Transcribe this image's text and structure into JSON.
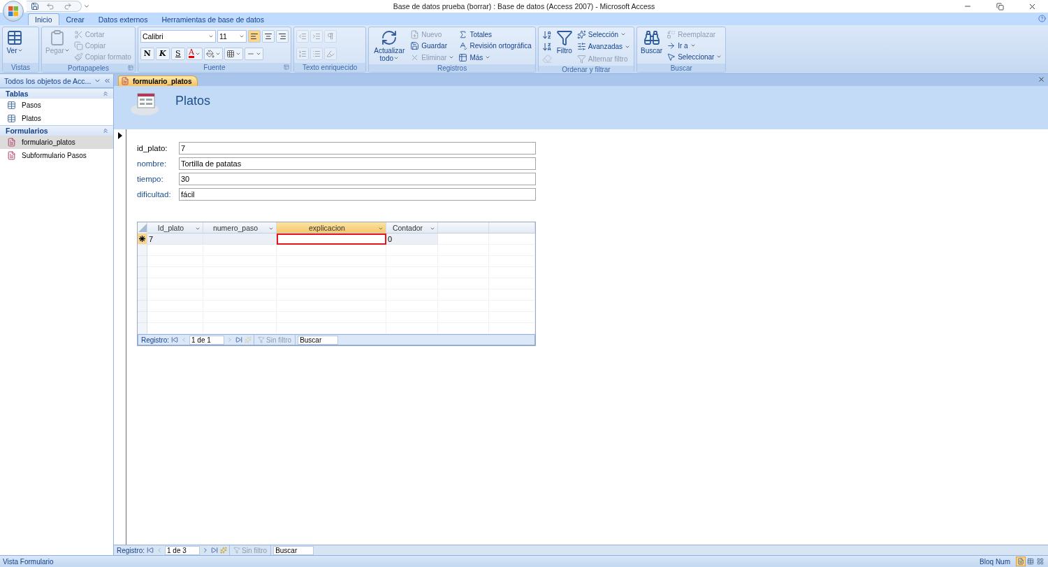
{
  "window": {
    "title": "Base de datos prueba (borrar) : Base de datos (Access 2007) - Microsoft Access"
  },
  "ribbon_tabs": [
    {
      "label": "Inicio",
      "selected": true
    },
    {
      "label": "Crear",
      "selected": false
    },
    {
      "label": "Datos externos",
      "selected": false
    },
    {
      "label": "Herramientas de base de datos",
      "selected": false
    }
  ],
  "ribbon_groups": [
    {
      "title": "Vistas",
      "kind": "buttons",
      "launcher": false,
      "columns": [
        [
          {
            "label": "Ver",
            "kind": "large",
            "dropdown": true,
            "disabled": false
          }
        ]
      ]
    },
    {
      "title": "Portapapeles",
      "kind": "buttons",
      "launcher": true,
      "columns": [
        [
          {
            "label": "Pegar",
            "kind": "large",
            "dropdown": true,
            "disabled": true
          }
        ],
        [
          {
            "label": "Cortar",
            "kind": "small",
            "dropdown": false,
            "disabled": true
          },
          {
            "label": "Copiar",
            "kind": "small",
            "dropdown": false,
            "disabled": true
          },
          {
            "label": "Copiar formato",
            "kind": "small",
            "dropdown": false,
            "disabled": true
          }
        ]
      ]
    },
    {
      "title": "Fuente",
      "kind": "font",
      "launcher": true,
      "font": "Calibri",
      "size": "11",
      "align": [
        {
          "selected": true
        },
        {
          "selected": false
        },
        {
          "selected": false
        }
      ],
      "format_buttons": [
        "N",
        "K",
        "S"
      ],
      "font_color_label": "A"
    },
    {
      "title": "Texto enriquecido",
      "kind": "icons",
      "launcher": false
    },
    {
      "title": "Registros",
      "kind": "buttons",
      "launcher": false,
      "columns": [
        [
          {
            "label": "Actualizar todo",
            "kind": "large",
            "dropdown": true,
            "disabled": false
          }
        ],
        [
          {
            "label": "Nuevo",
            "kind": "small",
            "dropdown": false,
            "disabled": true
          },
          {
            "label": "Guardar",
            "kind": "small",
            "dropdown": false,
            "disabled": false
          },
          {
            "label": "Eliminar",
            "kind": "small",
            "dropdown": true,
            "disabled": true
          }
        ],
        [
          {
            "label": "Totales",
            "kind": "small",
            "dropdown": false,
            "disabled": false
          },
          {
            "label": "Revisión ortográfica",
            "kind": "small",
            "dropdown": false,
            "disabled": false
          },
          {
            "label": "Más",
            "kind": "small",
            "dropdown": true,
            "disabled": false
          }
        ]
      ]
    },
    {
      "title": "Ordenar y filtrar",
      "kind": "buttons",
      "launcher": false,
      "columns": [
        [
          {
            "kind": "icon",
            "disabled": false
          },
          {
            "kind": "icon",
            "disabled": false
          },
          {
            "kind": "icon",
            "disabled": true
          }
        ],
        [
          {
            "label": "Filtro",
            "kind": "large",
            "dropdown": false,
            "disabled": false
          }
        ],
        [
          {
            "label": "Selección",
            "kind": "small",
            "dropdown": true,
            "disabled": false
          },
          {
            "label": "Avanzadas",
            "kind": "small",
            "dropdown": true,
            "disabled": false
          },
          {
            "label": "Alternar filtro",
            "kind": "small",
            "dropdown": false,
            "disabled": true
          }
        ]
      ]
    },
    {
      "title": "Buscar",
      "kind": "buttons",
      "launcher": false,
      "columns": [
        [
          {
            "label": "Buscar",
            "kind": "large",
            "dropdown": false,
            "disabled": false
          }
        ],
        [
          {
            "label": "Reemplazar",
            "kind": "small",
            "dropdown": false,
            "disabled": true
          },
          {
            "label": "Ir a",
            "kind": "small",
            "dropdown": true,
            "disabled": false
          },
          {
            "label": "Seleccionar",
            "kind": "small",
            "dropdown": true,
            "disabled": false
          }
        ]
      ]
    }
  ],
  "nav_pane": {
    "title": "Todos los objetos de Acc...",
    "sections": [
      {
        "title": "Tablas",
        "expanded": true,
        "items": [
          {
            "label": "Pasos",
            "kind": "table",
            "selected": false
          },
          {
            "label": "Platos",
            "kind": "table",
            "selected": false
          }
        ]
      },
      {
        "title": "Formularios",
        "expanded": true,
        "items": [
          {
            "label": "formulario_platos",
            "kind": "form",
            "selected": true
          },
          {
            "label": "Subformulario Pasos",
            "kind": "form",
            "selected": false
          }
        ]
      }
    ]
  },
  "document_tab": {
    "label": "formulario_platos",
    "selected": true
  },
  "form": {
    "title": "Platos",
    "fields": [
      {
        "label": "id_plato:",
        "value": "7",
        "color": "#000000"
      },
      {
        "label": "nombre:",
        "value": "Tortilla de patatas",
        "color": "#1f4e8c"
      },
      {
        "label": "tiempo:",
        "value": "30",
        "color": "#1f4e8c"
      },
      {
        "label": "dificultad:",
        "value": "fácil",
        "color": "#1f4e8c"
      }
    ],
    "subform": {
      "columns": [
        {
          "label": "Id_plato",
          "selected": false
        },
        {
          "label": "numero_paso",
          "selected": false
        },
        {
          "label": "explicacion",
          "selected": true
        },
        {
          "label": "Contador",
          "selected": false
        }
      ],
      "rows": [
        {
          "new": true,
          "cells": [
            {
              "value": "7",
              "focused": false
            },
            {
              "focused": false
            },
            {
              "focused": true
            },
            {
              "value": "0",
              "focused": false
            }
          ]
        }
      ],
      "navigation": {
        "label": "Registro:",
        "record": "1 de 1",
        "filter": "Sin filtro",
        "search_placeholder": "Buscar",
        "buttons": [
          {
            "disabled": false
          },
          {
            "disabled": true
          },
          {
            "disabled": true
          },
          {
            "disabled": false
          },
          {
            "disabled": true
          }
        ]
      }
    }
  },
  "navigation": {
    "label": "Registro:",
    "record": "1 de 3",
    "filter": "Sin filtro",
    "search_placeholder": "Buscar",
    "buttons": [
      {
        "disabled": false
      },
      {
        "disabled": true
      },
      {
        "disabled": false
      },
      {
        "disabled": false
      },
      {
        "disabled": false
      }
    ]
  },
  "status_bar": {
    "text": "Vista Formulario",
    "indicator": "Bloq Num",
    "views": [
      {
        "selected": true
      },
      {
        "selected": false
      },
      {
        "selected": false
      }
    ]
  }
}
